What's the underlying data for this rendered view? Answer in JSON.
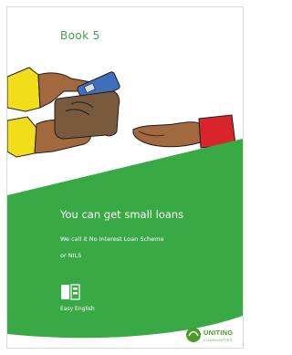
{
  "book_label": "Book 5",
  "title": "You can get small loans",
  "subtitle_line1": "We call it No Interest Loan Scheme",
  "subtitle_line2": "or NILS",
  "easy_english_label": "Easy English",
  "logo": {
    "name": "UNITING",
    "sub": "COMMUNITIES"
  },
  "colors": {
    "brand_green": "#38a945",
    "book_label": "#3aa64b",
    "white": "#ffffff"
  },
  "icons": {
    "illustration": "hands-wallet-card-illustration",
    "easy_english": "easy-english-book-icon",
    "logo": "uniting-communities-logo"
  }
}
